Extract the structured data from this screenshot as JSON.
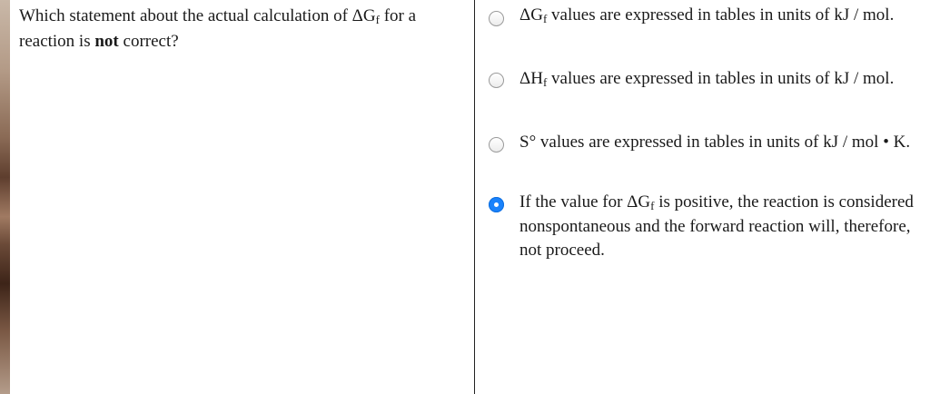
{
  "question": {
    "text_before": "Which statement about the actual calculation of ΔG",
    "text_sub": "f",
    "text_middle": " for a reaction is ",
    "text_bold": "not",
    "text_after": " correct?"
  },
  "options": [
    {
      "symbol": "ΔG",
      "sub": "f",
      "text": " values are expressed in tables in units of kJ / mol.",
      "selected": false
    },
    {
      "symbol": "ΔH",
      "sub": "f",
      "text": " values are expressed in tables in units of kJ / mol.",
      "selected": false
    },
    {
      "text": "S° values are expressed in tables in units of kJ / mol • K.",
      "selected": false
    },
    {
      "text_before": "If the value for ΔG",
      "sub": "f",
      "text_after": " is positive, the reaction is considered nonspontaneous and the forward reaction will, therefore, not proceed.",
      "selected": true
    }
  ],
  "colors": {
    "radio_selected": "#1a82fb",
    "divider": "#222222"
  }
}
